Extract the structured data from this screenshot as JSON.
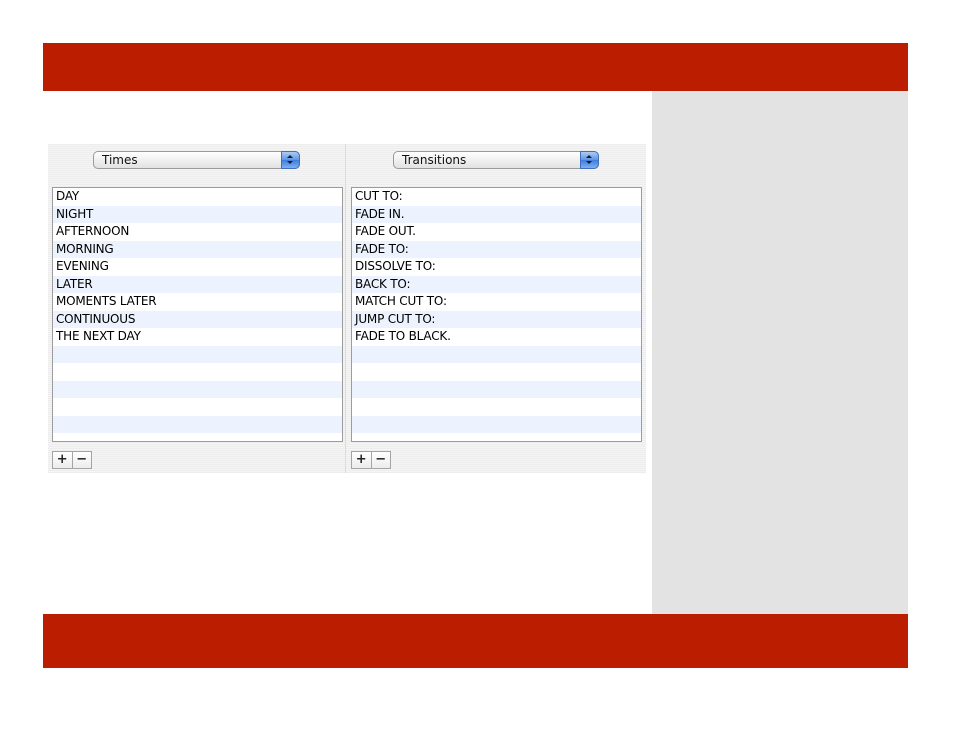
{
  "colors": {
    "band": "#bb1d00",
    "side_panel": "#e3e3e3"
  },
  "left_list": {
    "popup_label": "Times",
    "items": [
      "DAY",
      "NIGHT",
      "AFTERNOON",
      "MORNING",
      "EVENING",
      "LATER",
      "MOMENTS LATER",
      "CONTINUOUS",
      "THE NEXT DAY"
    ],
    "add_label": "+",
    "remove_label": "−"
  },
  "right_list": {
    "popup_label": "Transitions",
    "items": [
      "CUT TO:",
      "FADE IN.",
      "FADE OUT.",
      "FADE TO:",
      "DISSOLVE TO:",
      "BACK TO:",
      "MATCH CUT TO:",
      "JUMP CUT TO:",
      "FADE TO BLACK."
    ],
    "add_label": "+",
    "remove_label": "−"
  }
}
